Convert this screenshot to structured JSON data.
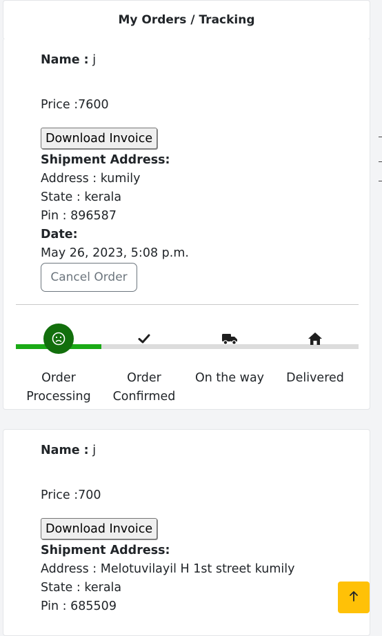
{
  "header": {
    "title": "My Orders / Tracking"
  },
  "orders": [
    {
      "name_label": "Name :",
      "name_value": "j",
      "price": "Price :7600",
      "download_label": "Download Invoice",
      "shipment_heading": "Shipment Address:",
      "address": "Address : kumily",
      "state": "State : kerala",
      "pin": "Pin : 896587",
      "date_heading": "Date:",
      "date_value": "May 26, 2023, 5:08 p.m.",
      "cancel_label": "Cancel Order",
      "progress": 0.25,
      "steps": [
        {
          "label": "Order Processing",
          "icon": "sad-face-icon"
        },
        {
          "label": "Order Confirmed",
          "icon": "check-icon"
        },
        {
          "label": "On the way",
          "icon": "truck-icon"
        },
        {
          "label": "Delivered",
          "icon": "home-icon"
        }
      ]
    },
    {
      "name_label": "Name :",
      "name_value": "j",
      "price": "Price :700",
      "download_label": "Download Invoice",
      "shipment_heading": "Shipment Address:",
      "address": "Address : Melotuvilayil H 1st street kumily",
      "state": "State : kerala",
      "pin": "Pin : 685509"
    }
  ],
  "scroll_top": {
    "icon": "arrow-up-icon",
    "color": "#ffc107"
  },
  "colors": {
    "progress_active": "#1aaa16",
    "step_active_bg": "#126f0c"
  }
}
